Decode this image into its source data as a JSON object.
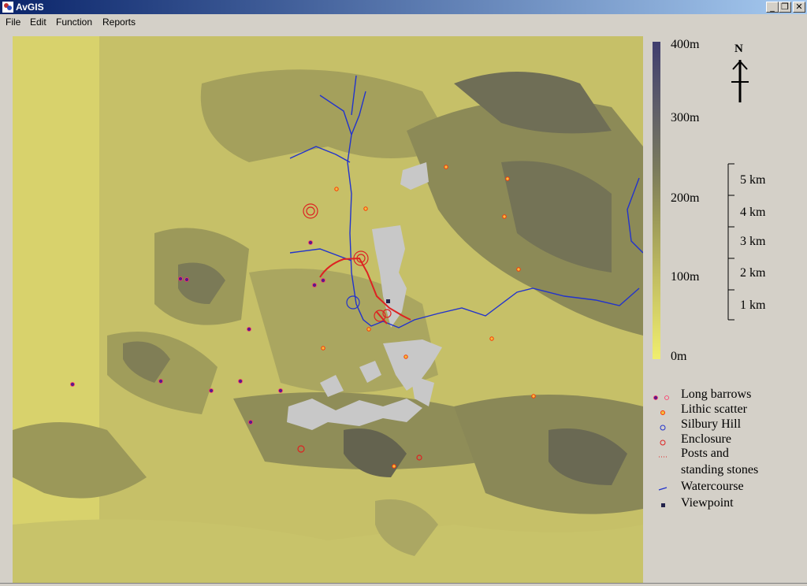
{
  "window": {
    "title": "AvGIS",
    "minimize_glyph": "_",
    "restore_glyph": "❐",
    "close_glyph": "✕"
  },
  "menu": [
    {
      "id": "file",
      "label": "File"
    },
    {
      "id": "edit",
      "label": "Edit"
    },
    {
      "id": "function",
      "label": "Function"
    },
    {
      "id": "reports",
      "label": "Reports"
    }
  ],
  "elevation_scale": {
    "labels": [
      "400m",
      "300m",
      "200m",
      "100m",
      "0m"
    ],
    "colors": {
      "high": "#3f3d6e",
      "mid": "#8c8c50",
      "low": "#f0ee6e"
    }
  },
  "north_arrow": {
    "label": "N"
  },
  "distance_scale": {
    "labels": [
      "5 km",
      "4 km",
      "3 km",
      "2 km",
      "1 km"
    ]
  },
  "legend": [
    {
      "label": "Long barrows",
      "icon": "long-barrow-marker"
    },
    {
      "label": "Lithic scatter",
      "icon": "lithic-scatter-marker"
    },
    {
      "label": "Silbury Hill",
      "icon": "silbury-hill-marker"
    },
    {
      "label": "Enclosure",
      "icon": "enclosure-marker"
    },
    {
      "label": "Posts and",
      "icon": "posts-stones-marker"
    },
    {
      "label": "standing stones",
      "icon": ""
    },
    {
      "label": "Watercourse",
      "icon": "watercourse-marker"
    },
    {
      "label": "Viewpoint",
      "icon": "viewpoint-marker"
    }
  ],
  "colors": {
    "long_barrow": "#5a1a8a",
    "lithic": "#ff3300",
    "silbury": "#2233cc",
    "enclosure": "#dd2222",
    "watercourse": "#2233cc",
    "viewpoint": "#22224a",
    "visible_area": "#c8c8c8"
  }
}
